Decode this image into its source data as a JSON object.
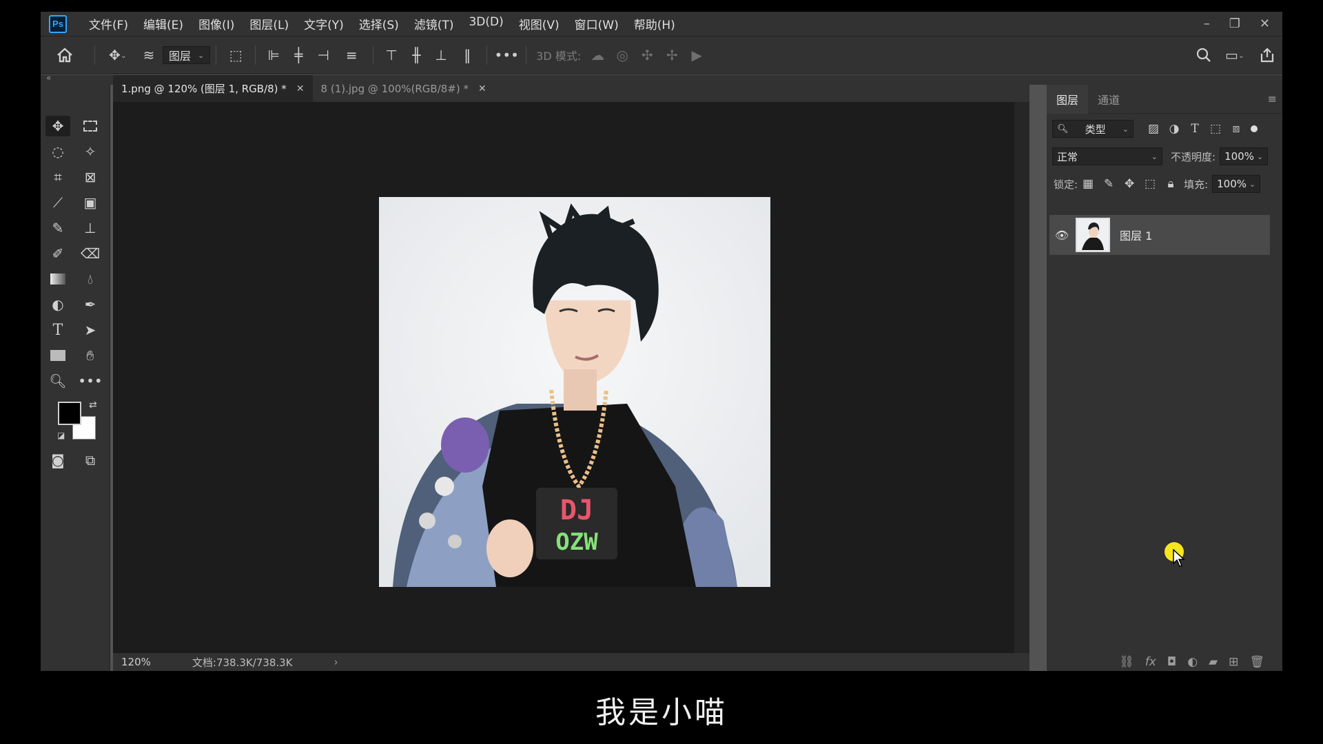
{
  "app": {
    "logo": "Ps"
  },
  "menu": [
    "文件(F)",
    "编辑(E)",
    "图像(I)",
    "图层(L)",
    "文字(Y)",
    "选择(S)",
    "滤镜(T)",
    "3D(D)",
    "视图(V)",
    "窗口(W)",
    "帮助(H)"
  ],
  "window_controls": {
    "minimize": "–",
    "restore": "❐",
    "close": "✕"
  },
  "options_bar": {
    "home_icon": "home-icon",
    "auto_select_value": "图层",
    "mode_3d_label": "3D 模式:",
    "more": "•••"
  },
  "tabs": [
    {
      "label": "1.png @ 120% (图层 1, RGB/8) *",
      "close": "✕",
      "active": true
    },
    {
      "label": "8 (1).jpg @ 100%(RGB/8#) *",
      "close": "✕",
      "active": false
    }
  ],
  "status": {
    "zoom": "120%",
    "doc": "文档:738.3K/738.3K",
    "arrow": "›"
  },
  "panel": {
    "tabs": [
      "图层",
      "通道"
    ],
    "filter_label": "类型",
    "blend_mode": "正常",
    "opacity_label": "不透明度:",
    "opacity_value": "100%",
    "lock_label": "锁定:",
    "fill_label": "填充:",
    "fill_value": "100%",
    "layers": [
      {
        "name": "图层 1",
        "visible": true
      }
    ]
  },
  "photo": {
    "badge_top": "DJ",
    "badge_bottom": "OZW"
  },
  "subtitle": "我是小喵",
  "colors": {
    "accent": "#31a8ff",
    "cursor_highlight": "#f5e61e",
    "foreground": "#000000",
    "background": "#ffffff"
  }
}
